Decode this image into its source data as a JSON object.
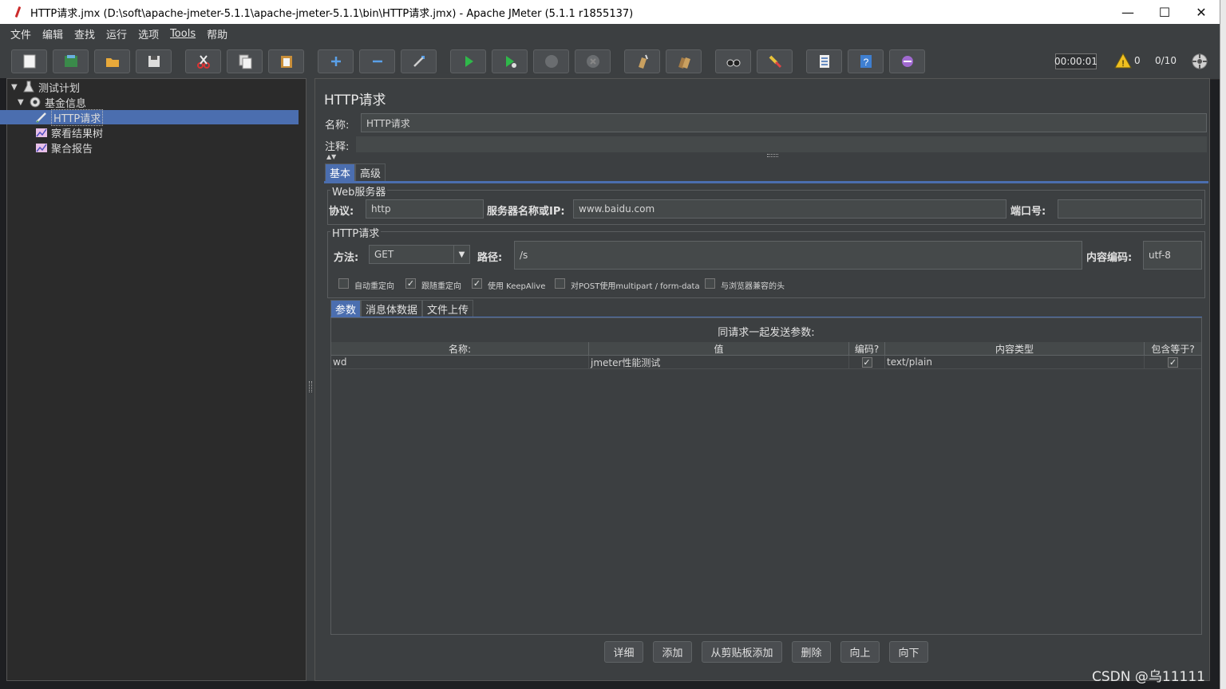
{
  "window": {
    "title": "HTTP请求.jmx (D:\\soft\\apache-jmeter-5.1.1\\apache-jmeter-5.1.1\\bin\\HTTP请求.jmx) - Apache JMeter (5.1.1 r1855137)",
    "minimize": "—",
    "maximize": "☐",
    "close": "✕"
  },
  "menu": [
    "文件",
    "编辑",
    "查找",
    "运行",
    "选项",
    "Tools",
    "帮助"
  ],
  "status": {
    "timer": "00:00:01",
    "warnings": "0",
    "threads": "0/10"
  },
  "tree": [
    {
      "label": "测试计划",
      "icon": "test-plan-icon"
    },
    {
      "label": "基金信息",
      "icon": "thread-group-gear-icon"
    },
    {
      "label": "HTTP请求",
      "icon": "sampler-pen-icon"
    },
    {
      "label": "察看结果树",
      "icon": "listener-chart-icon"
    },
    {
      "label": "聚合报告",
      "icon": "listener-chart-icon"
    }
  ],
  "panel": {
    "title": "HTTP请求",
    "name_label": "名称:",
    "name_value": "HTTP请求",
    "comment_label": "注释:",
    "tabs": [
      "基本",
      "高级"
    ],
    "web_server_group": "Web服务器",
    "protocol_label": "协议:",
    "protocol_value": "http",
    "server_label": "服务器名称或IP:",
    "server_value": "www.baidu.com",
    "port_label": "端口号:",
    "port_value": "",
    "http_request_group": "HTTP请求",
    "method_label": "方法:",
    "method_value": "GET",
    "path_label": "路径:",
    "path_value": "/s",
    "encoding_label": "内容编码:",
    "encoding_value": "utf-8",
    "checkboxes": [
      {
        "label": "自动重定向",
        "checked": false
      },
      {
        "label": "跟随重定向",
        "checked": true
      },
      {
        "label": "使用 KeepAlive",
        "checked": true
      },
      {
        "label": "对POST使用multipart / form-data",
        "checked": false
      },
      {
        "label": "与浏览器兼容的头",
        "checked": false
      }
    ],
    "sub_tabs": [
      "参数",
      "消息体数据",
      "文件上传"
    ],
    "table_caption": "同请求一起发送参数:",
    "columns": [
      "名称:",
      "值",
      "编码?",
      "内容类型",
      "包含等于?"
    ],
    "rows": [
      {
        "name": "wd",
        "value": "jmeter性能测试",
        "encode": true,
        "content_type": "text/plain",
        "include_equals": true
      }
    ],
    "buttons": [
      "详细",
      "添加",
      "从剪贴板添加",
      "删除",
      "向上",
      "向下"
    ]
  },
  "watermark": "CSDN @乌11111"
}
